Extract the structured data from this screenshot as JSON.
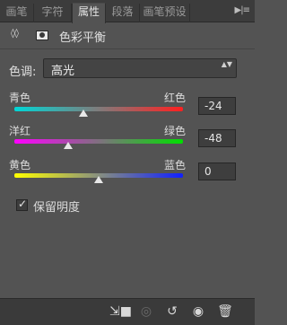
{
  "tabs": [
    {
      "label": "画笔",
      "active": false
    },
    {
      "label": "字符",
      "active": false
    },
    {
      "label": "属性",
      "active": true
    },
    {
      "label": "段落",
      "active": false
    },
    {
      "label": "画笔预设",
      "active": false
    }
  ],
  "tabbar_menu_glyph": "▶|≡",
  "header": {
    "adjust_glyph": "◊◊",
    "title": "色彩平衡"
  },
  "tone": {
    "label": "色调:",
    "value": "高光",
    "arrows": "▲▼"
  },
  "sliders": [
    {
      "left": "青色",
      "right": "红色",
      "value": "-24",
      "position": 0.41,
      "gradient": [
        "#00d7d7",
        "#ff2020"
      ]
    },
    {
      "left": "洋红",
      "right": "绿色",
      "value": "-48",
      "position": 0.32,
      "gradient": [
        "#ff00ff",
        "#00e000"
      ]
    },
    {
      "left": "黄色",
      "right": "蓝色",
      "value": "0",
      "position": 0.5,
      "gradient": [
        "#ffff00",
        "#1020ff"
      ]
    }
  ],
  "preserve": {
    "label": "保留明度",
    "checked": true,
    "mark": "✓"
  },
  "bottom_icons": [
    {
      "name": "clip-to-layer-icon",
      "glyph": "⇲■",
      "dim": false
    },
    {
      "name": "view-previous-icon",
      "glyph": "◎",
      "dim": true
    },
    {
      "name": "reset-icon",
      "glyph": "↺",
      "dim": false
    },
    {
      "name": "visibility-eye-icon",
      "glyph": "◉",
      "dim": false
    },
    {
      "name": "delete-icon",
      "glyph": "🗑",
      "dim": false
    }
  ]
}
